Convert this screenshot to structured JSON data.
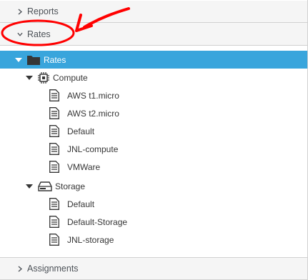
{
  "accordion": {
    "reports": {
      "label": "Reports",
      "icon": "chevron-right-icon"
    },
    "rates": {
      "label": "Rates",
      "icon": "chevron-down-icon"
    },
    "assignments": {
      "label": "Assignments",
      "icon": "chevron-right-icon"
    }
  },
  "tree": {
    "root": {
      "label": "Rates",
      "icon": "folder-icon"
    },
    "compute": {
      "label": "Compute",
      "icon": "chip-icon",
      "items": [
        "AWS t1.micro",
        "AWS t2.micro",
        "Default",
        "JNL-compute",
        "VMWare"
      ]
    },
    "storage": {
      "label": "Storage",
      "icon": "hard-drive-icon",
      "items": [
        "Default",
        "Default-Storage",
        "JNL-storage"
      ]
    }
  },
  "colors": {
    "selected": "#39a5dc",
    "annotation": "#ff0000",
    "header_bg": "#f5f5f5"
  }
}
